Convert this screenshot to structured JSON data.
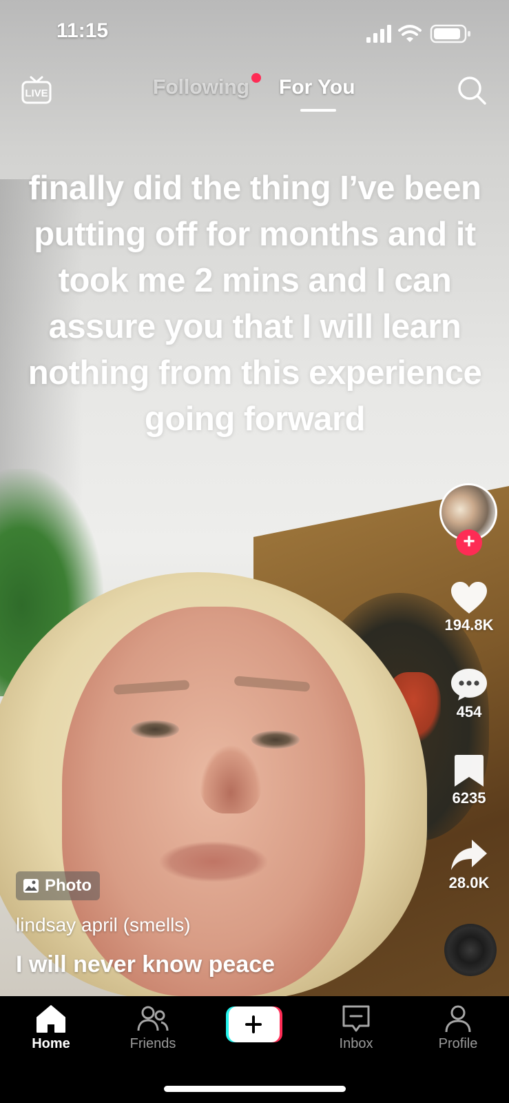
{
  "status_bar": {
    "time": "11:15"
  },
  "top_nav": {
    "live_label": "LIVE",
    "tabs": [
      {
        "label": "Following",
        "active": false,
        "has_notification_dot": true
      },
      {
        "label": "For You",
        "active": true
      }
    ]
  },
  "post": {
    "overlay_text": "finally did the thing I’ve been putting off for months and it took me 2 mins and I can assure you that I will learn nothing from this experience going forward",
    "badge": "Photo",
    "username": "lindsay april (smells)",
    "caption": "I will never know peace"
  },
  "rail": {
    "follow_symbol": "+",
    "likes": "194.8K",
    "comments": "454",
    "saves": "6235",
    "shares": "28.0K"
  },
  "bottom_nav": {
    "items": [
      {
        "label": "Home",
        "icon": "home-icon",
        "active": true
      },
      {
        "label": "Friends",
        "icon": "friends-icon",
        "active": false
      },
      {
        "label": "",
        "icon": "create-icon",
        "active": false
      },
      {
        "label": "Inbox",
        "icon": "inbox-icon",
        "active": false
      },
      {
        "label": "Profile",
        "icon": "profile-icon",
        "active": false
      }
    ]
  },
  "colors": {
    "accent": "#fe2c55",
    "cyan": "#25f4ee",
    "nav_bg": "#000000"
  }
}
